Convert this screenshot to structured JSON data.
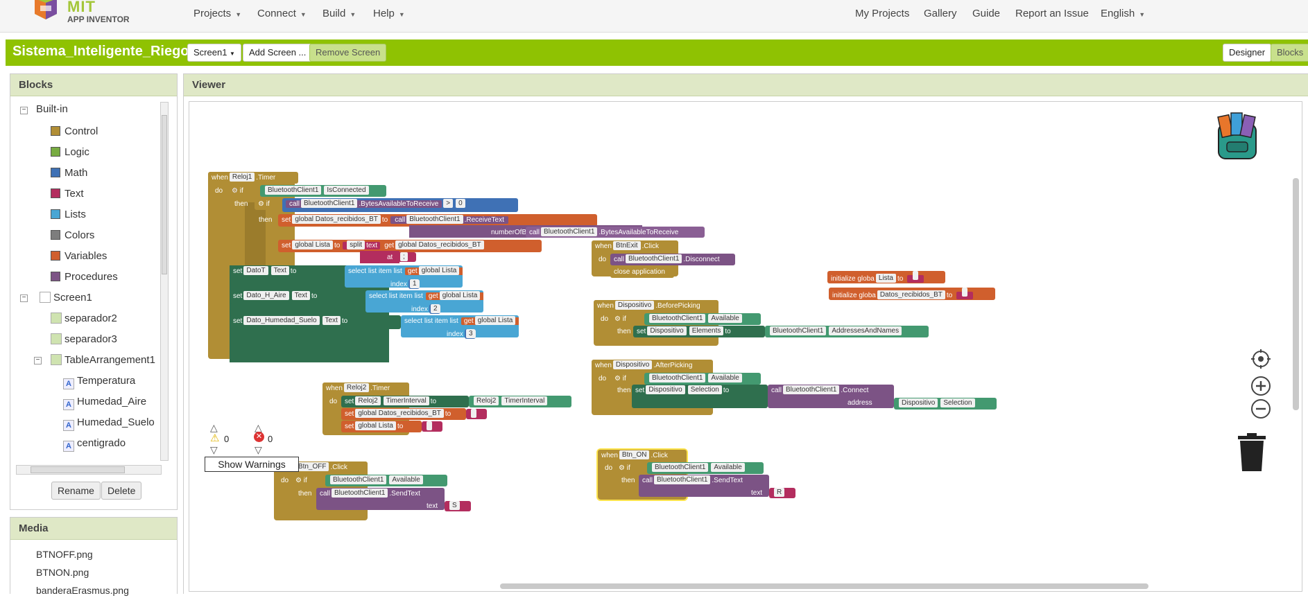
{
  "app": {
    "brand": "MIT",
    "subbrand": "APP INVENTOR"
  },
  "topnav": {
    "left": [
      {
        "label": "Projects"
      },
      {
        "label": "Connect"
      },
      {
        "label": "Build"
      },
      {
        "label": "Help"
      }
    ],
    "right": {
      "my_projects": "My Projects",
      "gallery": "Gallery",
      "guide": "Guide",
      "report": "Report an Issue",
      "language": "English"
    }
  },
  "project": {
    "title": "Sistema_Inteligente_Riego",
    "screen_select": "Screen1",
    "add_screen": "Add Screen ...",
    "remove_screen": "Remove Screen",
    "designer": "Designer",
    "blocks": "Blocks"
  },
  "blocks_panel": {
    "title": "Blocks",
    "builtin": "Built-in",
    "categories": [
      {
        "label": "Control",
        "color": "#b18e35"
      },
      {
        "label": "Logic",
        "color": "#77ab41"
      },
      {
        "label": "Math",
        "color": "#3f71b5"
      },
      {
        "label": "Text",
        "color": "#b32d5e"
      },
      {
        "label": "Lists",
        "color": "#49a6d4"
      },
      {
        "label": "Colors",
        "color": "#7d7d7d"
      },
      {
        "label": "Variables",
        "color": "#d05f2d"
      },
      {
        "label": "Procedures",
        "color": "#7c5385"
      }
    ],
    "screen": "Screen1",
    "components": [
      "separador2",
      "separador3",
      "TableArrangement1"
    ],
    "labels": [
      "Temperatura",
      "Humedad_Aire",
      "Humedad_Suelo",
      "centigrado"
    ],
    "rename": "Rename",
    "delete": "Delete"
  },
  "media_panel": {
    "title": "Media",
    "files": [
      "BTNOFF.png",
      "BTNON.png",
      "banderaErasmus.png"
    ]
  },
  "viewer": {
    "title": "Viewer",
    "warnings_count": "0",
    "errors_count": "0",
    "show_warnings": "Show Warnings"
  },
  "code": {
    "timer1": {
      "when": "when",
      "comp": "Reloj1",
      "event": ".Timer",
      "do": "do",
      "if": "if",
      "then": "then",
      "bt": "BluetoothClient1",
      "isconnected": "IsConnected",
      "call": "call",
      "bytes_avail": ".BytesAvailableToReceive",
      "gt": ">",
      "zero": "0",
      "set": "set",
      "global_datos": "global Datos_recibidos_BT",
      "to": "to",
      "receive": ".ReceiveText",
      "numbytes": "numberOfBytes",
      "global_lista": "global Lista",
      "split": "split",
      "text": "text",
      "get": "get",
      "at": "at",
      "datot": "DatoT",
      "text_prop": "Text",
      "select": "select list item",
      "list": "list",
      "index": "index",
      "i1": "1",
      "i2": "2",
      "i3": "3",
      "dato_aire": "Dato_H_Aire",
      "dato_suelo": "Dato_Humedad_Suelo"
    },
    "timer2": {
      "when": "when",
      "comp": "Reloj2",
      "event": ".Timer",
      "do": "do",
      "set": "set",
      "interval": "TimerInterval",
      "to": "to",
      "global_datos": "global Datos_recibidos_BT",
      "global_lista": "global Lista"
    },
    "btnoff": {
      "when": "when",
      "comp": "Btn_OFF",
      "event": ".Click",
      "do": "do",
      "if": "if",
      "then": "then",
      "bt": "BluetoothClient1",
      "available": "Available",
      "call": "call",
      "sendtext": ".SendText",
      "text": "text",
      "value": "S"
    },
    "btnexit": {
      "when": "when",
      "comp": "BtnExit",
      "event": ".Click",
      "do": "do",
      "call": "call",
      "bt": "BluetoothClient1",
      "disconnect": ".Disconnect",
      "close": "close application"
    },
    "beforepicking": {
      "when": "when",
      "comp": "Dispositivo",
      "event": ".BeforePicking",
      "do": "do",
      "if": "if",
      "then": "then",
      "bt": "BluetoothClient1",
      "available": "Available",
      "set": "set",
      "elements": "Elements",
      "to": "to",
      "addresses": "AddressesAndNames"
    },
    "afterpicking": {
      "when": "when",
      "comp": "Dispositivo",
      "event": ".AfterPicking",
      "do": "do",
      "if": "if",
      "then": "then",
      "bt": "BluetoothClient1",
      "available": "Available",
      "set": "set",
      "selection": "Selection",
      "to": "to",
      "call": "call",
      "connect": ".Connect",
      "address": "address"
    },
    "btnon": {
      "when": "when",
      "comp": "Btn_ON",
      "event": ".Click",
      "do": "do",
      "if": "if",
      "then": "then",
      "bt": "BluetoothClient1",
      "available": "Available",
      "call": "call",
      "sendtext": ".SendText",
      "text": "text",
      "value": "R"
    },
    "init1": {
      "label": "initialize globa",
      "name": "Lista",
      "to": "to"
    },
    "init2": {
      "label": "initialize globa",
      "name": "Datos_recibidos_BT",
      "to": "to"
    }
  }
}
